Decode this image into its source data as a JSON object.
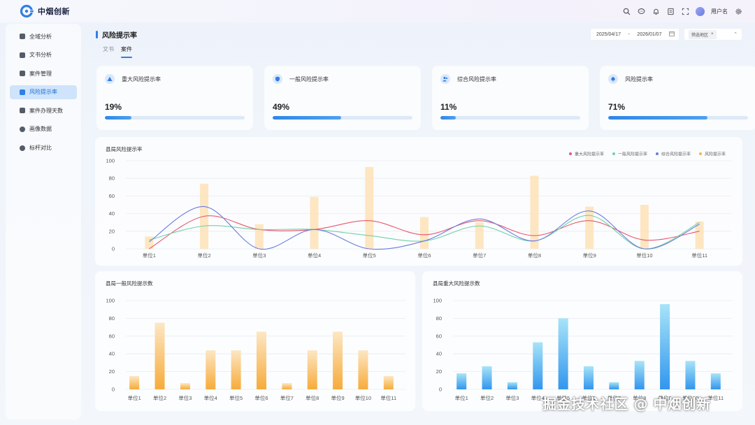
{
  "app": {
    "logo_text": "中烟创新",
    "username": "用户名"
  },
  "topbar_icons": [
    "search-icon",
    "message-icon",
    "bell-icon",
    "document-icon",
    "fullscreen-icon",
    "gear-icon"
  ],
  "sidebar": {
    "items": [
      {
        "label": "全域分析",
        "icon": "grid-icon",
        "active": false
      },
      {
        "label": "文书分析",
        "icon": "chart-icon",
        "active": false
      },
      {
        "label": "案件管理",
        "icon": "folder-icon",
        "active": false
      },
      {
        "label": "风险提示率",
        "icon": "alert-icon",
        "active": true
      },
      {
        "label": "案件办理天数",
        "icon": "calendar-icon",
        "active": false
      },
      {
        "label": "画像数据",
        "icon": "profile-icon",
        "active": false
      },
      {
        "label": "标杆对比",
        "icon": "check-icon",
        "active": false
      }
    ]
  },
  "header": {
    "title": "风险提示率",
    "date_start": "2025/04/17",
    "date_sep": "-",
    "date_end": "2026/01/07",
    "filter_tag": "筛选地区",
    "tabs": [
      {
        "label": "文书",
        "active": false
      },
      {
        "label": "案件",
        "active": true
      }
    ]
  },
  "stats": [
    {
      "label": "重大风险提示率",
      "value": "19%",
      "pct": 0.19,
      "icon": "warning-icon"
    },
    {
      "label": "一般风险提示率",
      "value": "49%",
      "pct": 0.49,
      "icon": "shield-icon"
    },
    {
      "label": "综合风险提示率",
      "value": "11%",
      "pct": 0.11,
      "icon": "users-icon"
    },
    {
      "label": "风险提示率",
      "value": "71%",
      "pct": 0.71,
      "icon": "bell-icon"
    }
  ],
  "colors": {
    "accent": "#2f7fe5",
    "red": "#e8586e",
    "green": "#6fd1a6",
    "blue": "#6a7be0",
    "bar_orange": "#f8b346",
    "bar_blue": "#3ea2f2"
  },
  "chart_data": [
    {
      "type": "line",
      "title": "县局风险提示率",
      "categories": [
        "单位1",
        "单位2",
        "单位3",
        "单位4",
        "单位5",
        "单位6",
        "单位7",
        "单位8",
        "单位9",
        "单位10",
        "单位11"
      ],
      "ylim": [
        0,
        100
      ],
      "yticks": [
        0,
        20,
        40,
        60,
        80,
        100
      ],
      "grid": true,
      "legend": "top-right",
      "series": [
        {
          "name": "重大风险提示率",
          "kind": "line",
          "color": "#e8586e",
          "values": [
            0,
            37,
            22,
            22,
            32,
            16,
            32,
            15,
            32,
            10,
            20
          ]
        },
        {
          "name": "一般风险提示率",
          "kind": "line",
          "color": "#6fd1a6",
          "values": [
            10,
            26,
            22,
            22,
            15,
            9,
            26,
            9,
            38,
            0,
            30
          ]
        },
        {
          "name": "综合风险提示率",
          "kind": "line",
          "color": "#6a7be0",
          "values": [
            8,
            48,
            0,
            22,
            0,
            9,
            34,
            9,
            43,
            0,
            28
          ]
        },
        {
          "name": "风险提示率",
          "kind": "bar",
          "color": "#fde2b6",
          "values": [
            14,
            74,
            28,
            59,
            93,
            36,
            30,
            83,
            48,
            50,
            31
          ]
        }
      ]
    },
    {
      "type": "bar",
      "title": "县局一般风险提示数",
      "categories": [
        "单位1",
        "单位2",
        "单位3",
        "单位4",
        "单位5",
        "单位6",
        "单位7",
        "单位8",
        "单位9",
        "单位10",
        "单位11"
      ],
      "values": [
        15,
        75,
        7,
        44,
        44,
        65,
        7,
        44,
        65,
        44,
        15
      ],
      "ylim": [
        0,
        100
      ],
      "yticks": [
        0,
        20,
        40,
        60,
        80,
        100
      ],
      "grid": true
    },
    {
      "type": "bar",
      "title": "县局重大风险提示数",
      "categories": [
        "单位1",
        "单位2",
        "单位3",
        "单位4",
        "单位5",
        "单位6",
        "单位7",
        "单位8",
        "单位9",
        "单位10",
        "单位11"
      ],
      "values": [
        18,
        26,
        8,
        53,
        80,
        26,
        8,
        32,
        96,
        32,
        18
      ],
      "ylim": [
        0,
        100
      ],
      "yticks": [
        0,
        20,
        40,
        60,
        80,
        100
      ],
      "grid": true
    }
  ],
  "watermark": "掘金技术社区 @ 中烟创新"
}
